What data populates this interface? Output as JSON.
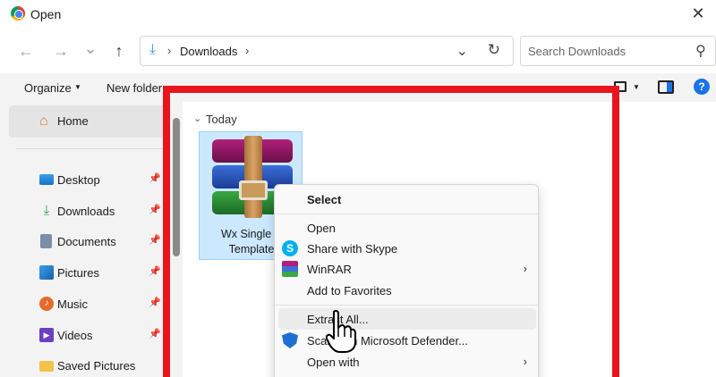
{
  "window": {
    "title": "Open",
    "close_glyph": "✕"
  },
  "nav": {
    "back_glyph": "←",
    "forward_glyph": "→",
    "recent_glyph": "⌄",
    "up_glyph": "↑",
    "breadcrumb": "Downloads",
    "search_placeholder": "Search Downloads"
  },
  "command_bar": {
    "organize_label": "Organize",
    "new_folder_label": "New folder"
  },
  "sidebar": {
    "home_label": "Home",
    "items": [
      {
        "label": "Desktop",
        "icon": "desktop-icon"
      },
      {
        "label": "Downloads",
        "icon": "downloads-icon"
      },
      {
        "label": "Documents",
        "icon": "documents-icon"
      },
      {
        "label": "Pictures",
        "icon": "pictures-icon"
      },
      {
        "label": "Music",
        "icon": "music-icon"
      },
      {
        "label": "Videos",
        "icon": "videos-icon"
      },
      {
        "label": "Saved Pictures",
        "icon": "folder-icon"
      }
    ]
  },
  "content": {
    "group_label": "Today",
    "file": {
      "name_line1": "Wx Single P",
      "name_line2": "Template"
    }
  },
  "context_menu": {
    "select_label": "Select",
    "items": [
      {
        "label": "Open"
      },
      {
        "label": "Share with Skype",
        "icon": "skype-icon"
      },
      {
        "label": "WinRAR",
        "icon": "winrar-icon",
        "submenu": true
      },
      {
        "label": "Add to Favorites"
      },
      {
        "label": "Extract All...",
        "hovered": true
      },
      {
        "label": "Scan with Microsoft Defender...",
        "icon": "defender-icon"
      },
      {
        "label": "Open with",
        "submenu": true
      }
    ]
  },
  "colors": {
    "highlight": "#e8141e",
    "accent": "#1a73e8",
    "selection": "#cce8ff"
  }
}
